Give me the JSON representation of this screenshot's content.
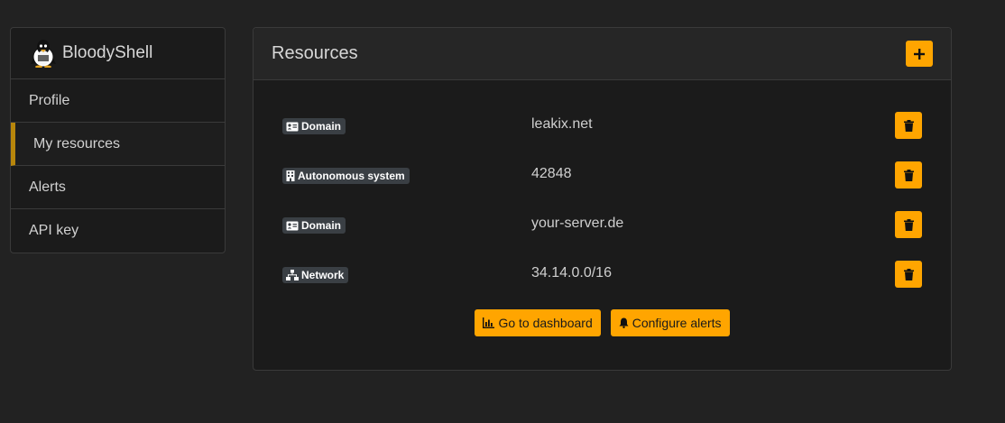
{
  "sidebar": {
    "username": "BloodyShell",
    "items": [
      {
        "label": "Profile",
        "active": false
      },
      {
        "label": "My resources",
        "active": true
      },
      {
        "label": "Alerts",
        "active": false
      },
      {
        "label": "API key",
        "active": false
      }
    ]
  },
  "resources": {
    "title": "Resources",
    "add_icon": "plus-icon",
    "rows": [
      {
        "type": "Domain",
        "type_icon": "id-card-icon",
        "value": "leakix.net"
      },
      {
        "type": "Autonomous system",
        "type_icon": "building-icon",
        "value": "42848"
      },
      {
        "type": "Domain",
        "type_icon": "id-card-icon",
        "value": "your-server.de"
      },
      {
        "type": "Network",
        "type_icon": "network-icon",
        "value": "34.14.0.0/16"
      }
    ],
    "delete_icon": "trash-icon",
    "actions": {
      "dashboard_label": "Go to dashboard",
      "dashboard_icon": "chart-icon",
      "alerts_label": "Configure alerts",
      "alerts_icon": "bell-icon"
    }
  },
  "colors": {
    "accent": "#ffa500",
    "background": "#222222",
    "panel": "#1b1b1b",
    "active_marker": "#b8860b",
    "badge": "#3a3f44"
  }
}
